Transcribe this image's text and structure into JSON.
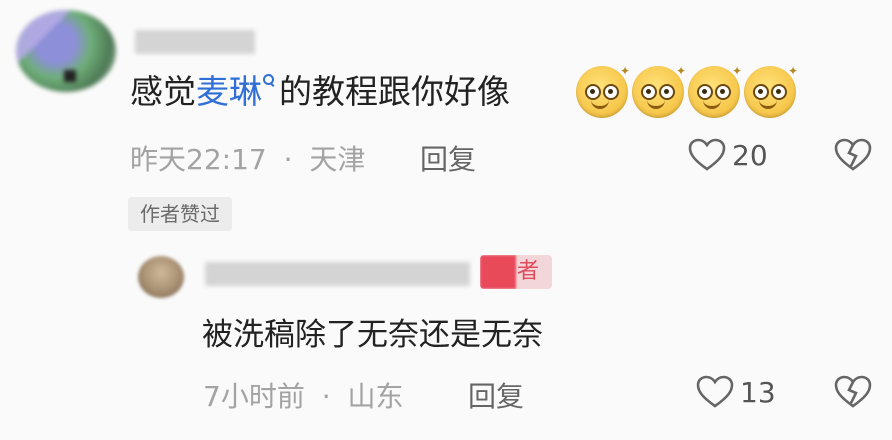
{
  "comment": {
    "text_before": "感觉",
    "link_text": "麦琳",
    "text_after": "的教程跟你好像",
    "emojis": [
      "smile-emoji",
      "smile-emoji",
      "smile-emoji",
      "smile-emoji"
    ],
    "time": "昨天22:17",
    "separator": "·",
    "location": "天津",
    "reply_label": "回复",
    "like_count": "20",
    "author_liked": "作者赞过"
  },
  "reply": {
    "author_badge": "者",
    "text": "被洗稿除了无奈还是无奈",
    "time": "7小时前",
    "separator": "·",
    "location": "山东",
    "reply_label": "回复",
    "like_count": "13"
  },
  "colors": {
    "link": "#2f6fd6",
    "muted": "#a3a3a3",
    "author_badge": "#e14a5b",
    "background": "#fafafa"
  }
}
